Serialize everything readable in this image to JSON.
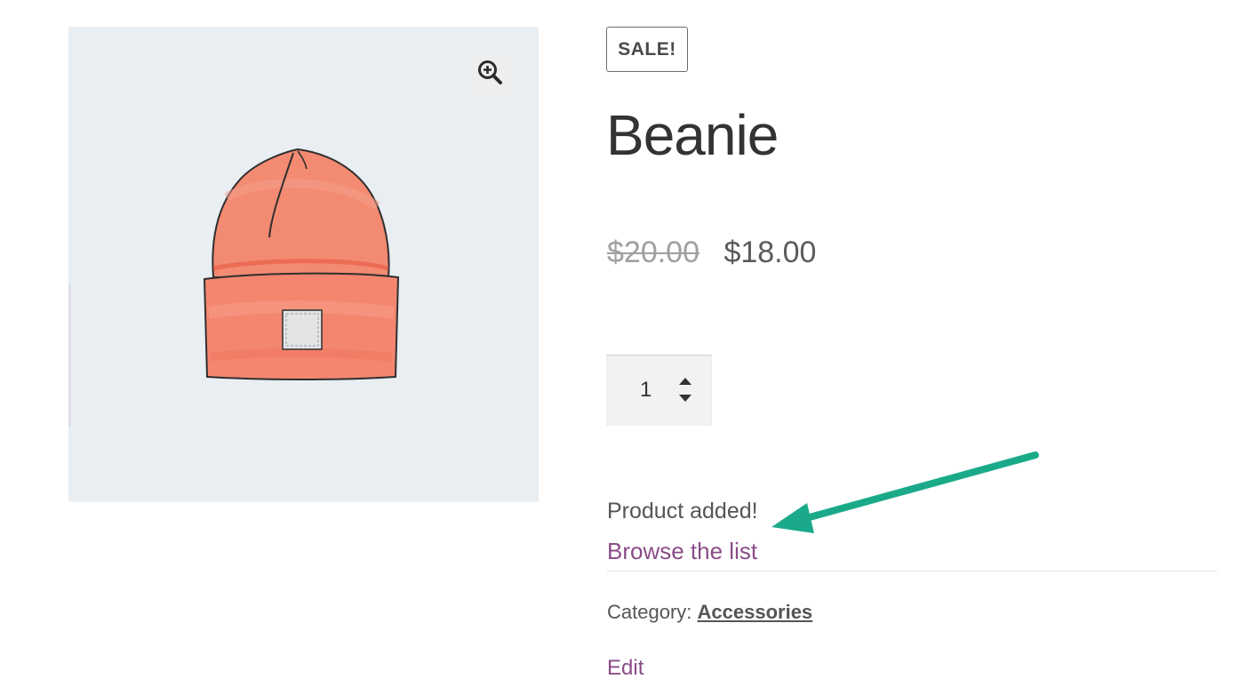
{
  "product": {
    "sale_badge": "SALE!",
    "title": "Beanie",
    "price_old": "$20.00",
    "price_new": "$18.00",
    "quantity": "1"
  },
  "wishlist": {
    "added_message": "Product added!",
    "browse_link": "Browse the list"
  },
  "meta": {
    "category_label": "Category:",
    "category_value": "Accessories",
    "edit_link": "Edit"
  },
  "icons": {
    "zoom": "zoom-in-icon",
    "qty_up": "caret-up-icon",
    "qty_down": "caret-down-icon"
  },
  "colors": {
    "link_purple": "#8a4c88",
    "annotation_arrow": "#1aaa8a",
    "gallery_bg": "#e9eef2",
    "beanie": "#f2826a"
  }
}
